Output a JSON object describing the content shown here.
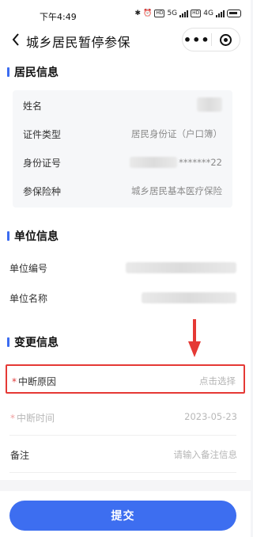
{
  "status_bar": {
    "time": "下午4:49",
    "network_labels": [
      "5G",
      "4G"
    ]
  },
  "nav": {
    "title": "城乡居民暂停参保",
    "more_glyph": "•••"
  },
  "resident_section": {
    "title": "居民信息",
    "rows": [
      {
        "label": "姓名",
        "value": ""
      },
      {
        "label": "证件类型",
        "value": "居民身份证（户口簿）"
      },
      {
        "label": "身份证号",
        "value": "*******22"
      },
      {
        "label": "参保险种",
        "value": "城乡居民基本医疗保险"
      }
    ]
  },
  "unit_section": {
    "title": "单位信息",
    "rows": [
      {
        "label": "单位编号",
        "value": ""
      },
      {
        "label": "单位名称",
        "value": ""
      }
    ]
  },
  "change_section": {
    "title": "变更信息",
    "reason": {
      "required_mark": "*",
      "label": "中断原因",
      "placeholder": "点击选择"
    },
    "time": {
      "required_mark": "*",
      "label": "中断时间",
      "value": "2023-05-23"
    },
    "remark": {
      "label": "备注",
      "placeholder": "请输入备注信息"
    }
  },
  "submit_label": "提交",
  "colors": {
    "accent": "#3d6ef0",
    "annotation": "#e53935",
    "required": "#e03a3a"
  }
}
